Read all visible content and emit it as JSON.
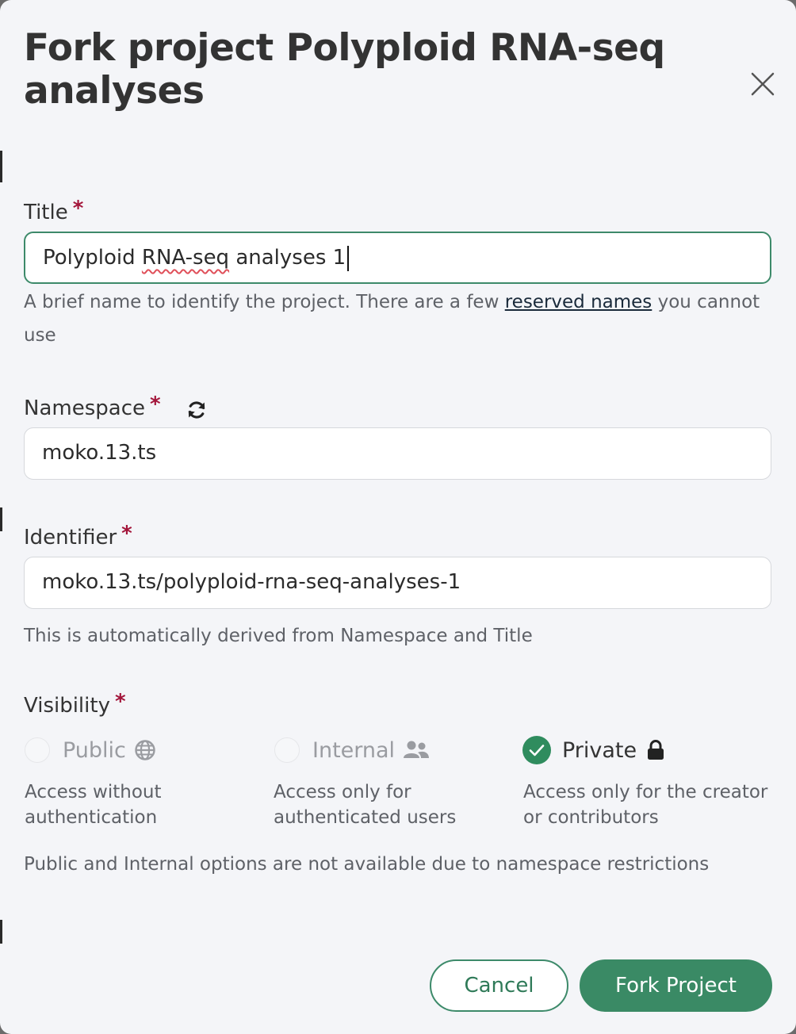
{
  "dialog": {
    "title": "Fork project Polyploid RNA-seq analyses"
  },
  "form": {
    "required_marker": "*",
    "title_field": {
      "label": "Title",
      "value_prefix": "Polyploid ",
      "value_flagged": "RNA-seq",
      "value_suffix": " analyses 1",
      "help_before": "A brief name to identify the project. There are a few ",
      "help_link": "reserved names",
      "help_after": " you cannot use"
    },
    "namespace_field": {
      "label": "Namespace",
      "value": "moko.13.ts",
      "refresh_icon": "refresh-icon"
    },
    "identifier_field": {
      "label": "Identifier",
      "value": "moko.13.ts/polyploid-rna-seq-analyses-1",
      "help": "This is automatically derived from Namespace and Title"
    },
    "visibility": {
      "label": "Visibility",
      "options": [
        {
          "label": "Public",
          "icon": "globe-icon",
          "description": "Access without authentication",
          "selected": false,
          "disabled": true
        },
        {
          "label": "Internal",
          "icon": "users-icon",
          "description": "Access only for authenticated users",
          "selected": false,
          "disabled": true
        },
        {
          "label": "Private",
          "icon": "lock-icon",
          "description": "Access only for the creator or contributors",
          "selected": true,
          "disabled": false
        }
      ],
      "note": "Public and Internal options are not available due to namespace restrictions"
    }
  },
  "actions": {
    "cancel_label": "Cancel",
    "fork_label": "Fork Project"
  },
  "colors": {
    "accent": "#3a8a65",
    "required": "#a3153a",
    "background": "#f4f5f8"
  }
}
